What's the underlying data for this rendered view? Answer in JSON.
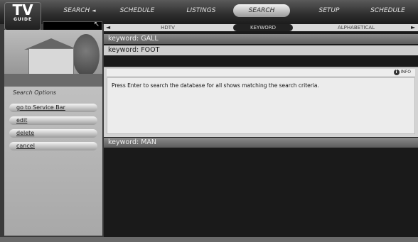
{
  "logo": {
    "main": "TV",
    "sub": "GUIDE"
  },
  "top_tabs": [
    {
      "label": "SEARCH",
      "active": false
    },
    {
      "label": "SCHEDULE",
      "active": false
    },
    {
      "label": "LISTINGS",
      "active": false
    },
    {
      "label": "SEARCH",
      "active": true
    },
    {
      "label": "SETUP",
      "active": false
    },
    {
      "label": "SCHEDULE",
      "active": false
    }
  ],
  "sub_tabs": [
    "HDTV",
    "KEYWORD",
    "ALPHABETICAL"
  ],
  "keywords": [
    "keyword: GALL",
    "keyword: FOOT",
    "keyword: MAN"
  ],
  "info_label": "INFO",
  "message": "Press Enter to search the database for all shows matching the search criteria.",
  "options": {
    "title": "Search Options",
    "buttons": [
      "go to Service Bar",
      "edit",
      "delete",
      "cancel"
    ]
  }
}
